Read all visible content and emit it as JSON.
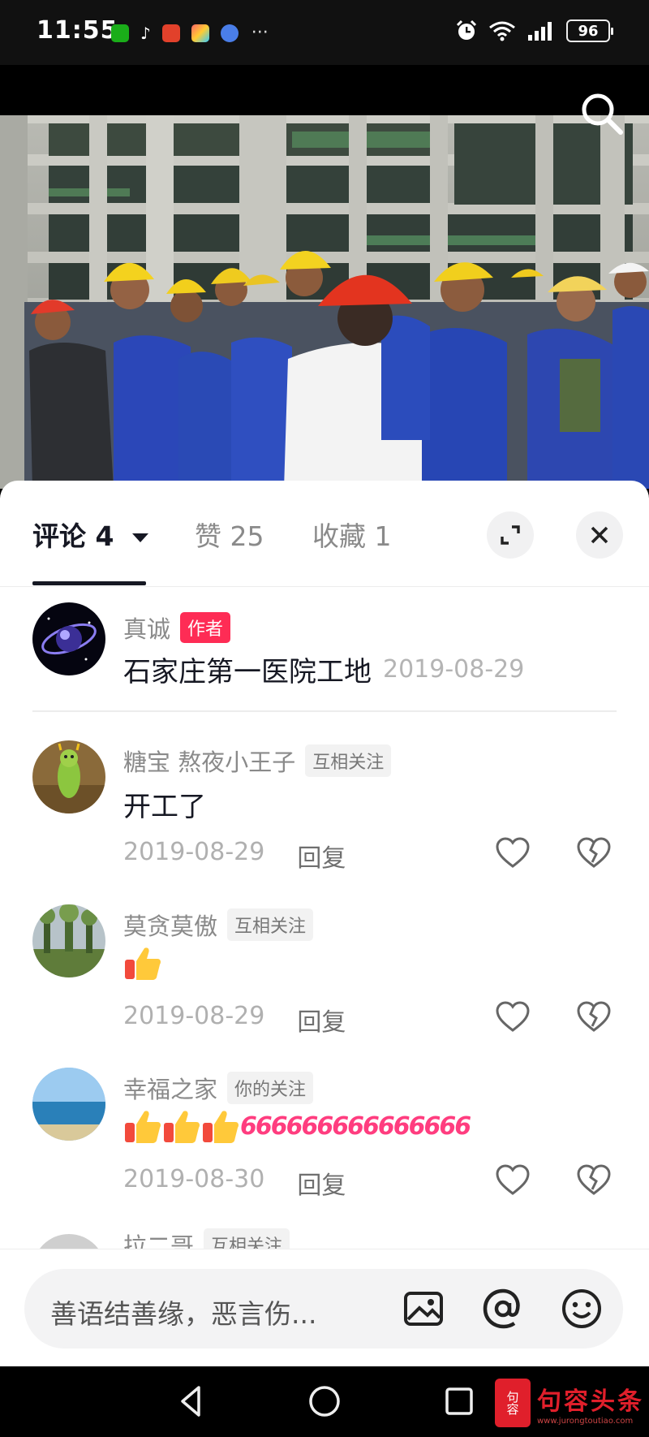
{
  "status_bar": {
    "time": "11:55",
    "battery": "96",
    "more": "···"
  },
  "tabs": [
    {
      "label": "评论 4",
      "active": true
    },
    {
      "label": "赞 25",
      "active": false
    },
    {
      "label": "收藏 1",
      "active": false
    }
  ],
  "comments": [
    {
      "name": "真诚",
      "badge": "作者",
      "text": "石家庄第一医院工地",
      "date": "2019-08-29"
    },
    {
      "name": "糖宝 熬夜小王子",
      "badge": "互相关注",
      "text": "开工了",
      "date": "2019-08-29",
      "reply": "回复"
    },
    {
      "name": "莫贪莫傲",
      "badge": "互相关注",
      "text": "",
      "date": "2019-08-29",
      "reply": "回复"
    },
    {
      "name": "幸福之家",
      "badge": "你的关注",
      "text": "",
      "date": "2019-08-30",
      "reply": "回复"
    },
    {
      "name": "拉二哥",
      "badge": "互相关注"
    }
  ],
  "emoji": {
    "six": "666"
  },
  "input": {
    "placeholder": "善语结善缘，恶言伤..."
  },
  "watermark": {
    "title": "句容头条",
    "url": "www.jurongtoutiao.com",
    "seal": "句容"
  },
  "colors": {
    "accent": "#fe2c55",
    "text_primary": "#161823",
    "text_secondary": "#8a8a8a",
    "six_pink": "#ff3d7f"
  }
}
